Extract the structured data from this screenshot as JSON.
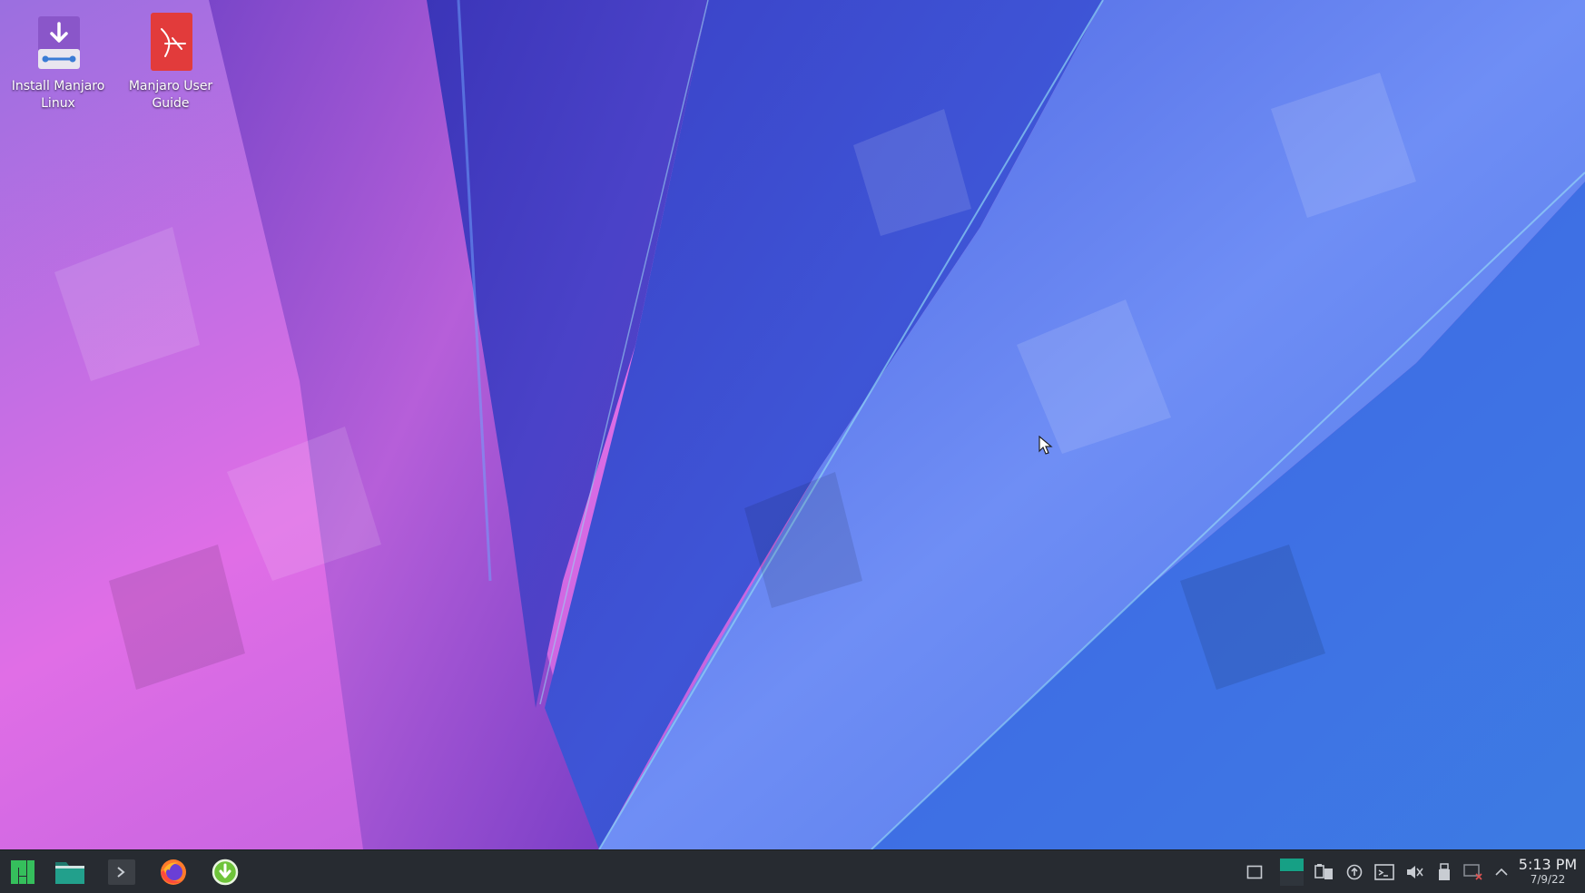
{
  "desktop": {
    "icons": [
      {
        "label": "Install Manjaro Linux",
        "icon": "install-download-icon"
      },
      {
        "label": "Manjaro User Guide",
        "icon": "pdf-document-icon"
      }
    ]
  },
  "taskbar": {
    "launchers": [
      {
        "icon": "manjaro-menu-icon"
      },
      {
        "icon": "file-manager-folder-icon"
      },
      {
        "icon": "terminal-icon"
      },
      {
        "icon": "firefox-icon"
      },
      {
        "icon": "installer-download-icon"
      }
    ],
    "tray": [
      {
        "icon": "show-desktop-icon"
      },
      {
        "icon": "virtual-desktop-pager-icon"
      },
      {
        "icon": "clipboard-icon"
      },
      {
        "icon": "update-arrow-icon"
      },
      {
        "icon": "console-icon"
      },
      {
        "icon": "volume-muted-icon"
      },
      {
        "icon": "usb-device-icon"
      },
      {
        "icon": "network-disconnected-icon"
      },
      {
        "icon": "expand-tray-chevron-icon"
      }
    ],
    "clock": {
      "time": "5:13 PM",
      "date": "7/9/22"
    }
  },
  "colors": {
    "taskbar_bg": "#272b31",
    "manjaro_green": "#35bf5c",
    "accent_teal": "#16a085"
  }
}
